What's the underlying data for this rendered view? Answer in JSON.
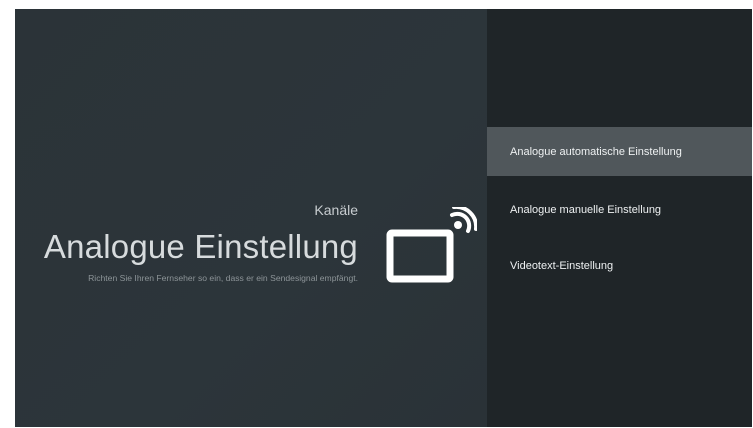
{
  "header": {
    "category": "Kanäle",
    "title": "Analogue Einstellung",
    "description": "Richten Sie Ihren Fernseher so ein, dass er ein Sendesignal empfängt."
  },
  "icon": {
    "name": "tv-signal-icon",
    "color": "#ffffff"
  },
  "menu": {
    "items": [
      {
        "label": "Analogue automatische Einstellung",
        "selected": true
      },
      {
        "label": "Analogue manuelle Einstellung",
        "selected": false
      },
      {
        "label": "Videotext-Einstellung",
        "selected": false
      }
    ]
  },
  "colors": {
    "left_panel": "#2b3338",
    "right_panel": "#1f2528",
    "selected_item": "#50575b"
  }
}
